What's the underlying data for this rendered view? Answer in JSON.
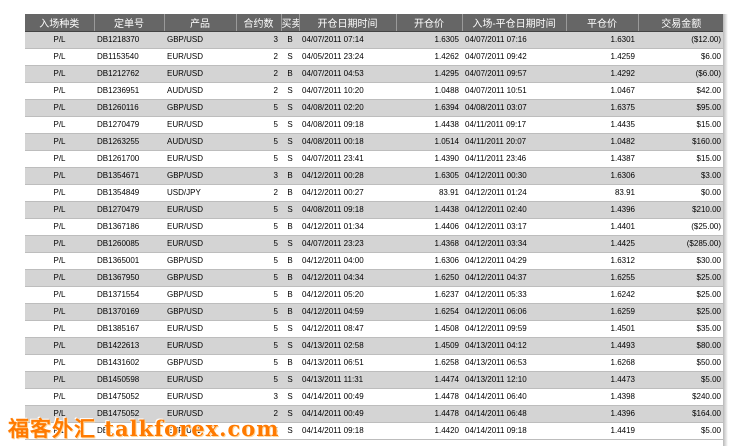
{
  "table": {
    "headers": [
      "入场种类",
      "定单号",
      "产品",
      "合约数",
      "买卖",
      "开仓日期时间",
      "开仓价",
      "入场-平仓日期时间",
      "平仓价",
      "交易金额"
    ],
    "rows": [
      [
        "P/L",
        "DB1218370",
        "GBP/USD",
        "3",
        "B",
        "04/07/2011 07:14",
        "1.6305",
        "04/07/2011 07:16",
        "1.6301",
        "($12.00)"
      ],
      [
        "P/L",
        "DB1153540",
        "EUR/USD",
        "2",
        "S",
        "04/05/2011 23:24",
        "1.4262",
        "04/07/2011 09:42",
        "1.4259",
        "$6.00"
      ],
      [
        "P/L",
        "DB1212762",
        "EUR/USD",
        "2",
        "B",
        "04/07/2011 04:53",
        "1.4295",
        "04/07/2011 09:57",
        "1.4292",
        "($6.00)"
      ],
      [
        "P/L",
        "DB1236951",
        "AUD/USD",
        "2",
        "S",
        "04/07/2011 10:20",
        "1.0488",
        "04/07/2011 10:51",
        "1.0467",
        "$42.00"
      ],
      [
        "P/L",
        "DB1260116",
        "GBP/USD",
        "5",
        "S",
        "04/08/2011 02:20",
        "1.6394",
        "04/08/2011 03:07",
        "1.6375",
        "$95.00"
      ],
      [
        "P/L",
        "DB1270479",
        "EUR/USD",
        "5",
        "S",
        "04/08/2011 09:18",
        "1.4438",
        "04/11/2011 09:17",
        "1.4435",
        "$15.00"
      ],
      [
        "P/L",
        "DB1263255",
        "AUD/USD",
        "5",
        "S",
        "04/08/2011 00:18",
        "1.0514",
        "04/11/2011 20:07",
        "1.0482",
        "$160.00"
      ],
      [
        "P/L",
        "DB1261700",
        "EUR/USD",
        "5",
        "S",
        "04/07/2011 23:41",
        "1.4390",
        "04/11/2011 23:46",
        "1.4387",
        "$15.00"
      ],
      [
        "P/L",
        "DB1354671",
        "GBP/USD",
        "3",
        "B",
        "04/12/2011 00:28",
        "1.6305",
        "04/12/2011 00:30",
        "1.6306",
        "$3.00"
      ],
      [
        "P/L",
        "DB1354849",
        "USD/JPY",
        "2",
        "B",
        "04/12/2011 00:27",
        "83.91",
        "04/12/2011 01:24",
        "83.91",
        "$0.00"
      ],
      [
        "P/L",
        "DB1270479",
        "EUR/USD",
        "5",
        "S",
        "04/08/2011 09:18",
        "1.4438",
        "04/12/2011 02:40",
        "1.4396",
        "$210.00"
      ],
      [
        "P/L",
        "DB1367186",
        "EUR/USD",
        "5",
        "B",
        "04/12/2011 01:34",
        "1.4406",
        "04/12/2011 03:17",
        "1.4401",
        "($25.00)"
      ],
      [
        "P/L",
        "DB1260085",
        "EUR/USD",
        "5",
        "S",
        "04/07/2011 23:23",
        "1.4368",
        "04/12/2011 03:34",
        "1.4425",
        "($285.00)"
      ],
      [
        "P/L",
        "DB1365001",
        "GBP/USD",
        "5",
        "B",
        "04/12/2011 04:00",
        "1.6306",
        "04/12/2011 04:29",
        "1.6312",
        "$30.00"
      ],
      [
        "P/L",
        "DB1367950",
        "GBP/USD",
        "5",
        "B",
        "04/12/2011 04:34",
        "1.6250",
        "04/12/2011 04:37",
        "1.6255",
        "$25.00"
      ],
      [
        "P/L",
        "DB1371554",
        "GBP/USD",
        "5",
        "B",
        "04/12/2011 05:20",
        "1.6237",
        "04/12/2011 05:33",
        "1.6242",
        "$25.00"
      ],
      [
        "P/L",
        "DB1370169",
        "GBP/USD",
        "5",
        "B",
        "04/12/2011 04:59",
        "1.6254",
        "04/12/2011 06:06",
        "1.6259",
        "$25.00"
      ],
      [
        "P/L",
        "DB1385167",
        "EUR/USD",
        "5",
        "S",
        "04/12/2011 08:47",
        "1.4508",
        "04/12/2011 09:59",
        "1.4501",
        "$35.00"
      ],
      [
        "P/L",
        "DB1422613",
        "EUR/USD",
        "5",
        "S",
        "04/13/2011 02:58",
        "1.4509",
        "04/13/2011 04:12",
        "1.4493",
        "$80.00"
      ],
      [
        "P/L",
        "DB1431602",
        "GBP/USD",
        "5",
        "B",
        "04/13/2011 06:51",
        "1.6258",
        "04/13/2011 06:53",
        "1.6268",
        "$50.00"
      ],
      [
        "P/L",
        "DB1450598",
        "EUR/USD",
        "5",
        "S",
        "04/13/2011 11:31",
        "1.4474",
        "04/13/2011 12:10",
        "1.4473",
        "$5.00"
      ],
      [
        "P/L",
        "DB1475052",
        "EUR/USD",
        "3",
        "S",
        "04/14/2011 00:49",
        "1.4478",
        "04/14/2011 06:40",
        "1.4398",
        "$240.00"
      ],
      [
        "P/L",
        "DB1475052",
        "EUR/USD",
        "2",
        "S",
        "04/14/2011 00:49",
        "1.4478",
        "04/14/2011 06:48",
        "1.4396",
        "$164.00"
      ],
      [
        "P/L",
        "DB1",
        "EUR/USD",
        "5",
        "S",
        "04/14/2011 09:18",
        "1.4420",
        "04/14/2011 09:18",
        "1.4419",
        "$5.00"
      ]
    ]
  },
  "watermark": "福客外汇 talkforex.com"
}
